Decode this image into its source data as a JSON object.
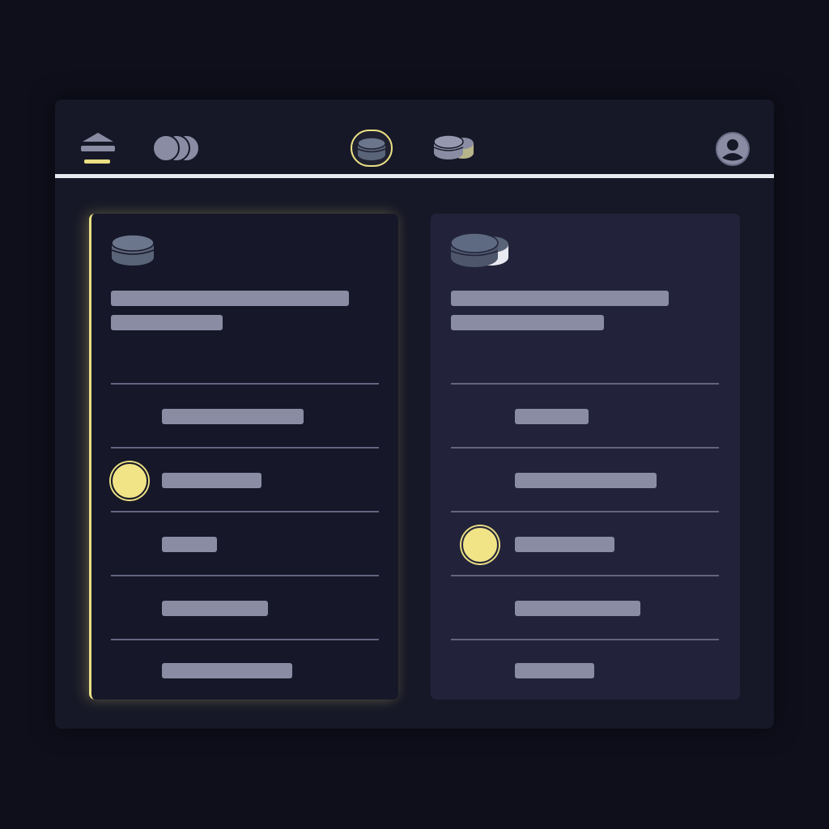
{
  "colors": {
    "background": "#0e0f1b",
    "window": "#171827",
    "accent": "#eadf83",
    "card_selected": "#161728",
    "card_unselected": "#22233a",
    "placeholder": "#8a8ca4"
  },
  "toolbar": {
    "icons": [
      "menu-icon",
      "coins-icon",
      "stack-icon",
      "coins-stack-icon",
      "user-avatar-icon"
    ],
    "active_tab": "stack-icon"
  },
  "cards": [
    {
      "name": "left-card",
      "selected": true,
      "icon": "stack-icon",
      "selected_row": 2,
      "row_count": 5
    },
    {
      "name": "right-card",
      "selected": false,
      "icon": "coins-stack-icon",
      "selected_row": 3,
      "row_count": 5
    }
  ]
}
